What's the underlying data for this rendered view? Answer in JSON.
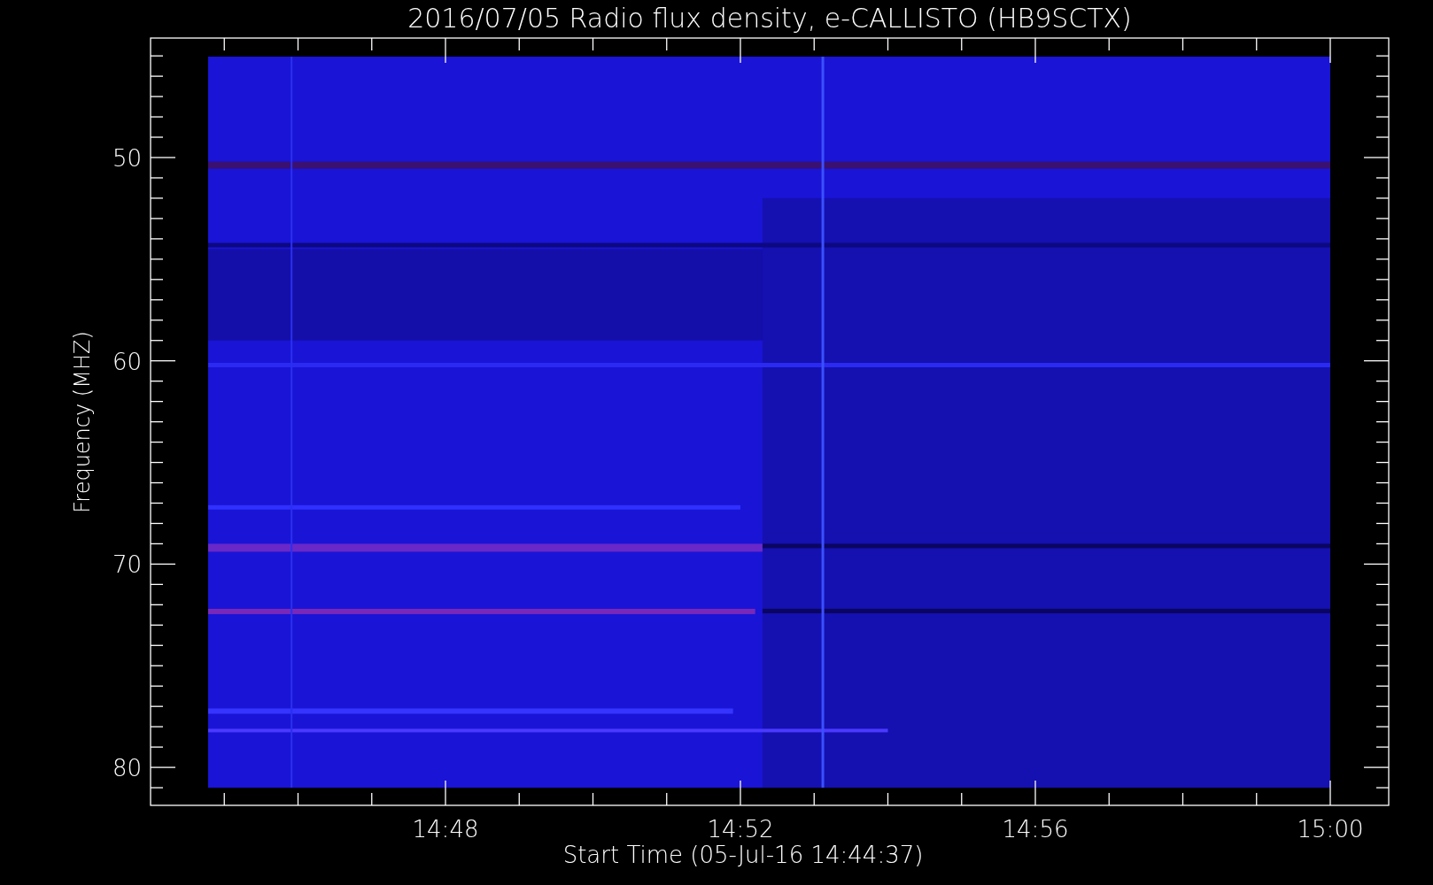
{
  "title": "2016/07/05  Radio flux density, e-CALLISTO (HB9SCTX)",
  "y_axis": {
    "label": "Frequency (MHZ)",
    "ticks": [
      "50",
      "60",
      "70",
      "80"
    ]
  },
  "x_axis": {
    "label": "Start Time (05-Jul-16 14:44:37)",
    "ticks": [
      "14:48",
      "14:52",
      "14:56",
      "15:00"
    ]
  }
}
